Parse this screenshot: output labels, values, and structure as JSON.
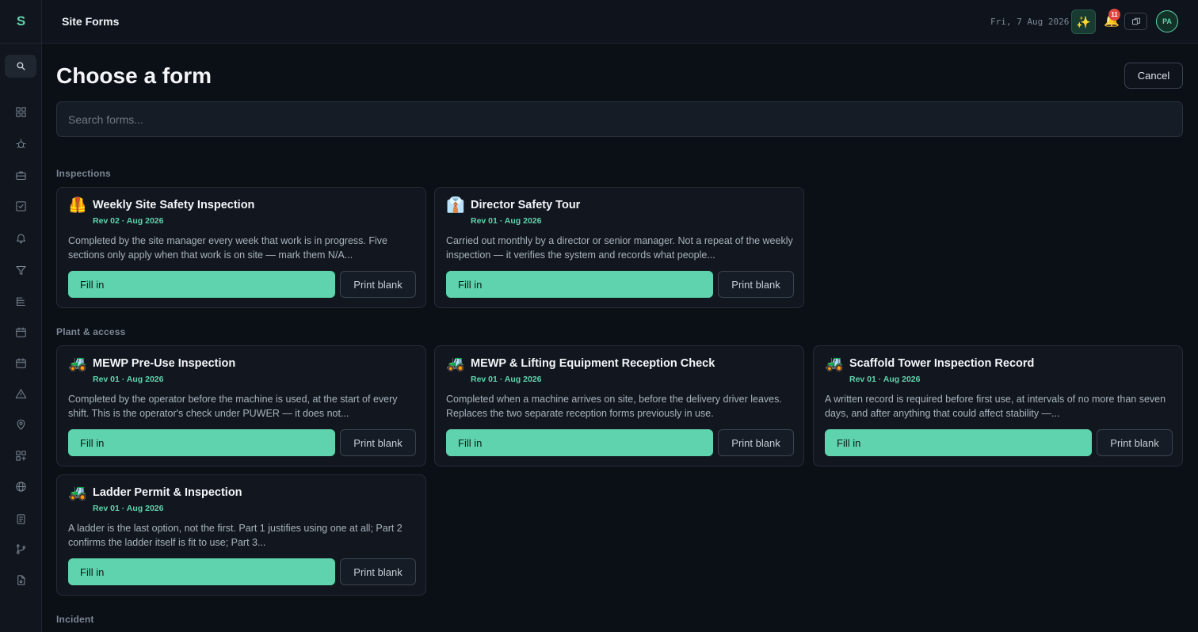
{
  "app": {
    "logo": "S",
    "title": "Site Forms"
  },
  "topbar": {
    "date": "Fri, 7 Aug 2026",
    "notification_count": "11",
    "avatar_initials": "PA",
    "sparkle": "✨",
    "bell": "🔔"
  },
  "page": {
    "title": "Choose a form",
    "cancel_label": "Cancel"
  },
  "search": {
    "placeholder": "Search forms..."
  },
  "sidebar": {
    "icons": [
      "search-icon",
      "grid-icon",
      "bug-icon",
      "briefcase-icon",
      "check-square-icon",
      "bell-icon",
      "filter-icon",
      "list-icon",
      "calendar-icon",
      "calendar-days-icon",
      "warning-icon",
      "map-pin-icon",
      "apps-icon",
      "globe-icon",
      "document-icon",
      "git-branch-icon",
      "file-icon"
    ]
  },
  "sections": [
    {
      "label": "Inspections",
      "forms": [
        {
          "emoji": "🦺",
          "title": "Weekly Site Safety Inspection",
          "rev": "Rev 02 · Aug 2026",
          "desc": "Completed by the site manager every week that work is in progress. Five sections only apply when that work is on site — mark them N/A...",
          "fill_label": "Fill in",
          "print_label": "Print blank"
        },
        {
          "emoji": "👔",
          "title": "Director Safety Tour",
          "rev": "Rev 01 · Aug 2026",
          "desc": "Carried out monthly by a director or senior manager. Not a repeat of the weekly inspection — it verifies the system and records what people...",
          "fill_label": "Fill in",
          "print_label": "Print blank"
        }
      ]
    },
    {
      "label": "Plant & access",
      "forms": [
        {
          "emoji": "🚜",
          "title": "MEWP Pre-Use Inspection",
          "rev": "Rev 01 · Aug 2026",
          "desc": "Completed by the operator before the machine is used, at the start of every shift. This is the operator's check under PUWER — it does not...",
          "fill_label": "Fill in",
          "print_label": "Print blank"
        },
        {
          "emoji": "🚜",
          "title": "MEWP & Lifting Equipment Reception Check",
          "rev": "Rev 01 · Aug 2026",
          "desc": "Completed when a machine arrives on site, before the delivery driver leaves. Replaces the two separate reception forms previously in use.",
          "fill_label": "Fill in",
          "print_label": "Print blank"
        },
        {
          "emoji": "🚜",
          "title": "Scaffold Tower Inspection Record",
          "rev": "Rev 01 · Aug 2026",
          "desc": "A written record is required before first use, at intervals of no more than seven days, and after anything that could affect stability —...",
          "fill_label": "Fill in",
          "print_label": "Print blank"
        },
        {
          "emoji": "🚜",
          "title": "Ladder Permit & Inspection",
          "rev": "Rev 01 · Aug 2026",
          "desc": "A ladder is the last option, not the first. Part 1 justifies using one at all; Part 2 confirms the ladder itself is fit to use; Part 3...",
          "fill_label": "Fill in",
          "print_label": "Print blank"
        }
      ]
    },
    {
      "label": "Incident",
      "forms": []
    }
  ]
}
